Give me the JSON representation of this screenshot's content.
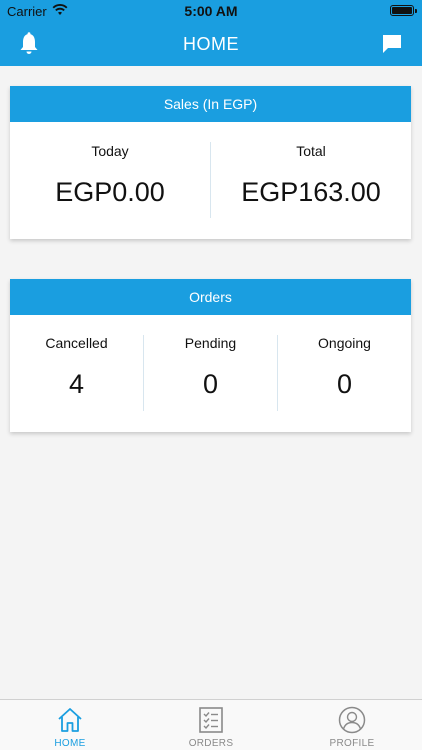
{
  "status_bar": {
    "carrier": "Carrier",
    "time": "5:00 AM"
  },
  "header": {
    "title": "HOME"
  },
  "sales_card": {
    "title": "Sales (In EGP)",
    "today_label": "Today",
    "today_value": "EGP0.00",
    "total_label": "Total",
    "total_value": "EGP163.00"
  },
  "orders_card": {
    "title": "Orders",
    "cancelled_label": "Cancelled",
    "cancelled_value": "4",
    "pending_label": "Pending",
    "pending_value": "0",
    "ongoing_label": "Ongoing",
    "ongoing_value": "0"
  },
  "tabs": [
    {
      "label": "HOME",
      "icon": "home-icon",
      "active": true
    },
    {
      "label": "ORDERS",
      "icon": "orders-icon",
      "active": false
    },
    {
      "label": "PROFILE",
      "icon": "profile-icon",
      "active": false
    }
  ],
  "colors": {
    "accent": "#1a9ee0",
    "background": "#f4f4f4",
    "inactive": "#8a8a8a"
  }
}
